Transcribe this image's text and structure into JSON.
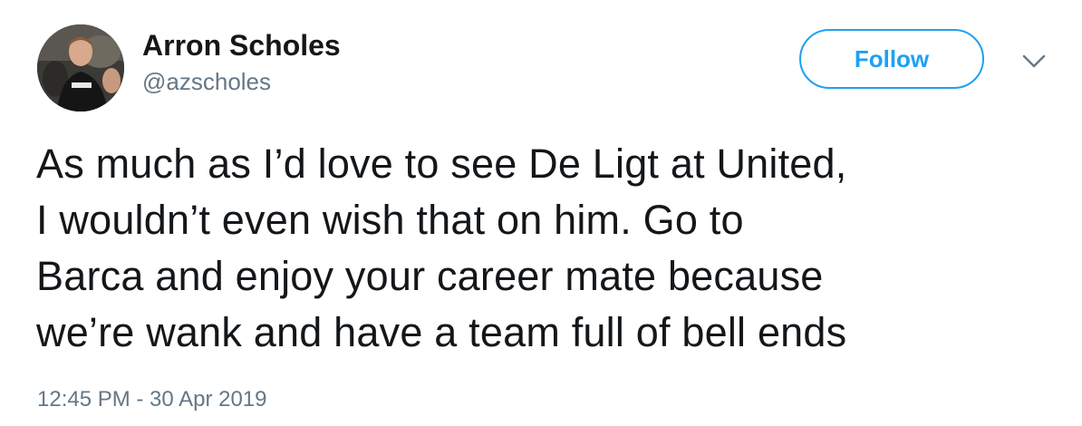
{
  "author": {
    "display_name": "Arron Scholes",
    "handle": "@azscholes",
    "avatar_icon": "profile-photo"
  },
  "actions": {
    "follow_label": "Follow",
    "more_icon": "chevron-down-icon"
  },
  "tweet": {
    "lines": [
      "As much as I’d love to see De Ligt at United,",
      "I wouldn’t even wish that on him. Go to",
      "Barca and enjoy your career mate because",
      "we’re wank and have a team full of bell ends"
    ],
    "timestamp": "12:45 PM - 30 Apr 2019"
  },
  "colors": {
    "accent": "#1da1f2",
    "text": "#14171a",
    "secondary_text": "#657786"
  }
}
